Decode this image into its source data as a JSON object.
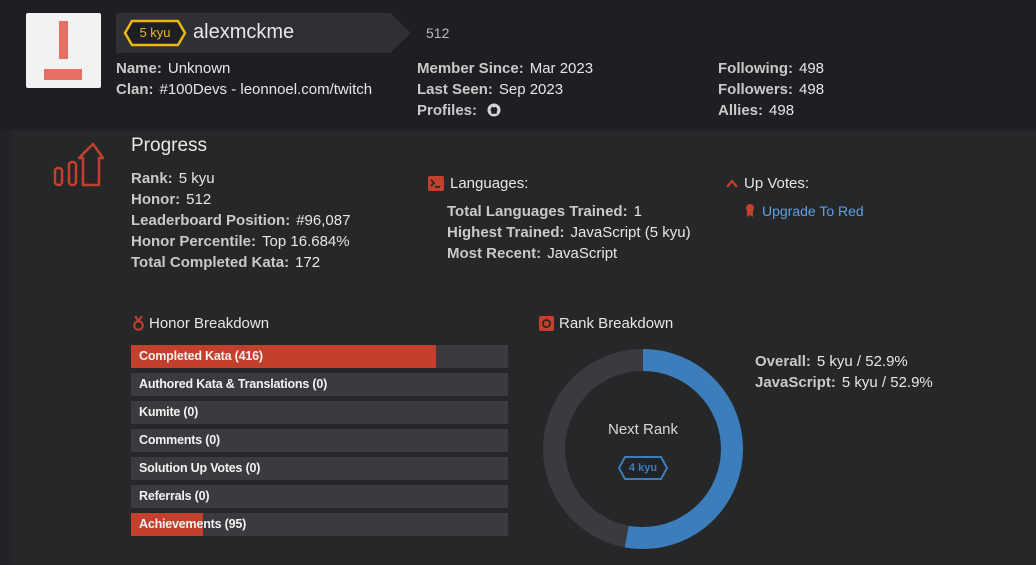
{
  "user": {
    "kyu": "5 kyu",
    "username": "alexmckme",
    "honor": "512"
  },
  "info_col1": [
    {
      "key": "Name:",
      "value": "Unknown"
    },
    {
      "key": "Clan:",
      "value": "#100Devs - leonnoel.com/twitch"
    }
  ],
  "info_col2": [
    {
      "key": "Member Since:",
      "value": "Mar 2023"
    },
    {
      "key": "Last Seen:",
      "value": "Sep 2023"
    },
    {
      "key": "Profiles:",
      "value": "",
      "icon": "github-icon"
    }
  ],
  "info_col3": [
    {
      "key": "Following:",
      "value": "498"
    },
    {
      "key": "Followers:",
      "value": "498"
    },
    {
      "key": "Allies:",
      "value": "498"
    }
  ],
  "progress": {
    "title": "Progress",
    "items": [
      {
        "key": "Rank:",
        "value": "5 kyu"
      },
      {
        "key": "Honor:",
        "value": "512"
      },
      {
        "key": "Leaderboard Position:",
        "value": "#96,087"
      },
      {
        "key": "Honor Percentile:",
        "value": "Top 16.684%"
      },
      {
        "key": "Total Completed Kata:",
        "value": "172"
      }
    ]
  },
  "languages": {
    "title": "Languages:",
    "items": [
      {
        "key": "Total Languages Trained:",
        "value": "1"
      },
      {
        "key": "Highest Trained:",
        "value": "JavaScript (5 kyu)"
      },
      {
        "key": "Most Recent:",
        "value": "JavaScript"
      }
    ]
  },
  "upvotes": {
    "title": "Up Votes:",
    "link": "Upgrade To Red"
  },
  "honor_breakdown": {
    "title": "Honor Breakdown",
    "rows": [
      {
        "label": "Completed Kata (416)",
        "fill": 0.81
      },
      {
        "label": "Authored Kata & Translations (0)",
        "fill": 0
      },
      {
        "label": "Kumite (0)",
        "fill": 0
      },
      {
        "label": "Comments (0)",
        "fill": 0
      },
      {
        "label": "Solution Up Votes (0)",
        "fill": 0
      },
      {
        "label": "Referrals (0)",
        "fill": 0
      },
      {
        "label": "Achievements (95)",
        "fill": 0.19
      }
    ]
  },
  "rank_breakdown": {
    "title": "Rank Breakdown",
    "next_rank_label": "Next Rank",
    "next_rank_badge": "4 kyu",
    "progress_fraction": 0.529,
    "items": [
      {
        "key": "Overall:",
        "value": "5 kyu / 52.9%"
      },
      {
        "key": "JavaScript:",
        "value": "5 kyu / 52.9%"
      }
    ]
  },
  "colors": {
    "accent_red": "#c2402c",
    "rank_blue": "#3c7ebb",
    "kyu_yellow": "#ecb613",
    "link_blue": "#5fa1e0"
  }
}
